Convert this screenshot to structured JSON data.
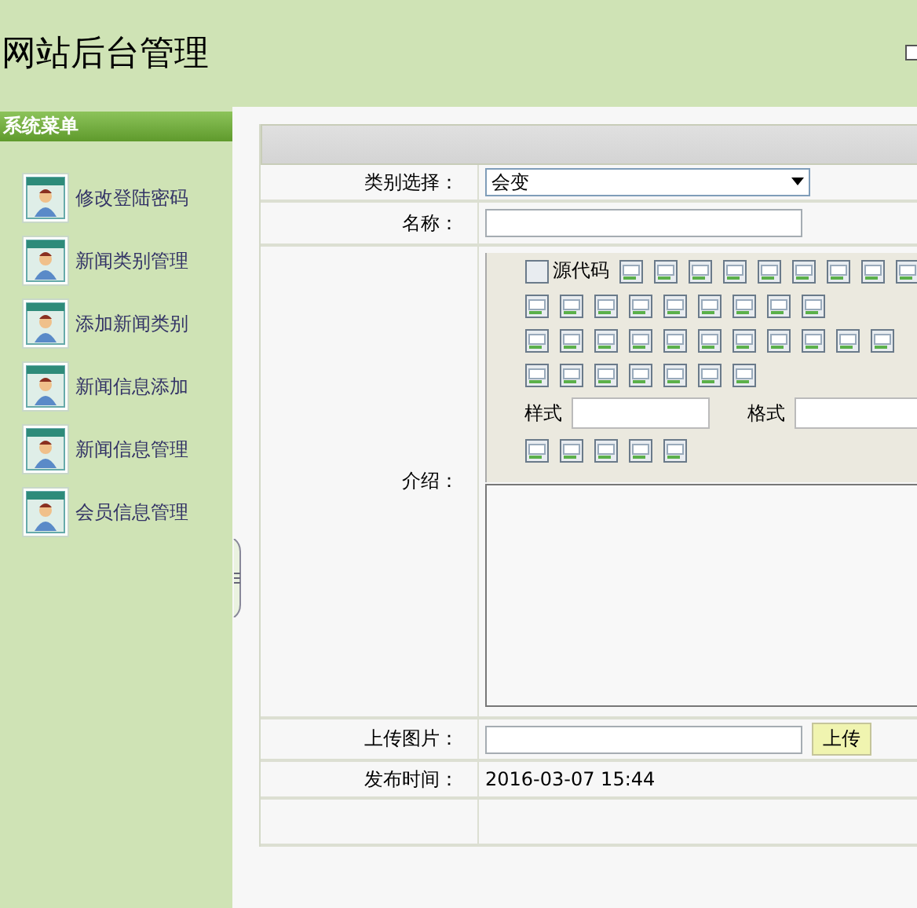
{
  "header": {
    "title": "网站后台管理"
  },
  "sidebar": {
    "title": "系统菜单",
    "items": [
      {
        "label": "修改登陆密码"
      },
      {
        "label": "新闻类别管理"
      },
      {
        "label": "添加新闻类别"
      },
      {
        "label": "新闻信息添加"
      },
      {
        "label": "新闻信息管理"
      },
      {
        "label": "会员信息管理"
      }
    ]
  },
  "form": {
    "category": {
      "label": "类别选择：",
      "value": "会变"
    },
    "name": {
      "label": "名称："
    },
    "intro": {
      "label": "介绍：",
      "source_button": "源代码",
      "style_label": "样式",
      "format_label": "格式"
    },
    "upload": {
      "label": "上传图片：",
      "button": "上传"
    },
    "publish_time": {
      "label": "发布时间：",
      "value": "2016-03-07 15:44"
    }
  }
}
